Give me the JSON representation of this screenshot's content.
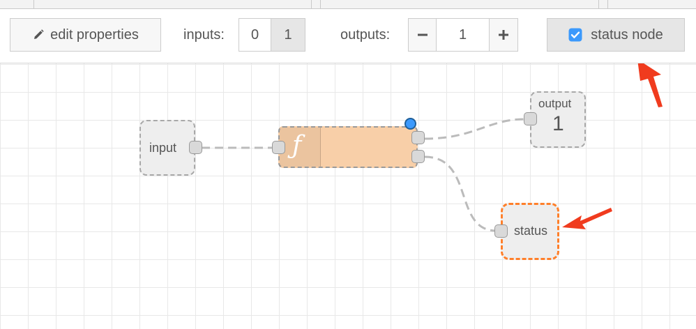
{
  "toolbar": {
    "edit_label": "edit properties",
    "inputs_label": "inputs:",
    "inputs_options": [
      "0",
      "1"
    ],
    "outputs_label": "outputs:",
    "outputs_minus": "−",
    "outputs_value": "1",
    "outputs_plus": "+",
    "status_label": "status node",
    "status_checked": true
  },
  "nodes": {
    "input_label": "input",
    "function_icon": "ƒ",
    "output_title": "output",
    "output_number": "1",
    "status_label": "status"
  },
  "colors": {
    "accent_blue": "#3b99fc",
    "function_node": "#f8cfa8",
    "status_border": "#ff7f2a",
    "arrow_red": "#f03b1e",
    "wire_gray": "#bbbbbb"
  }
}
